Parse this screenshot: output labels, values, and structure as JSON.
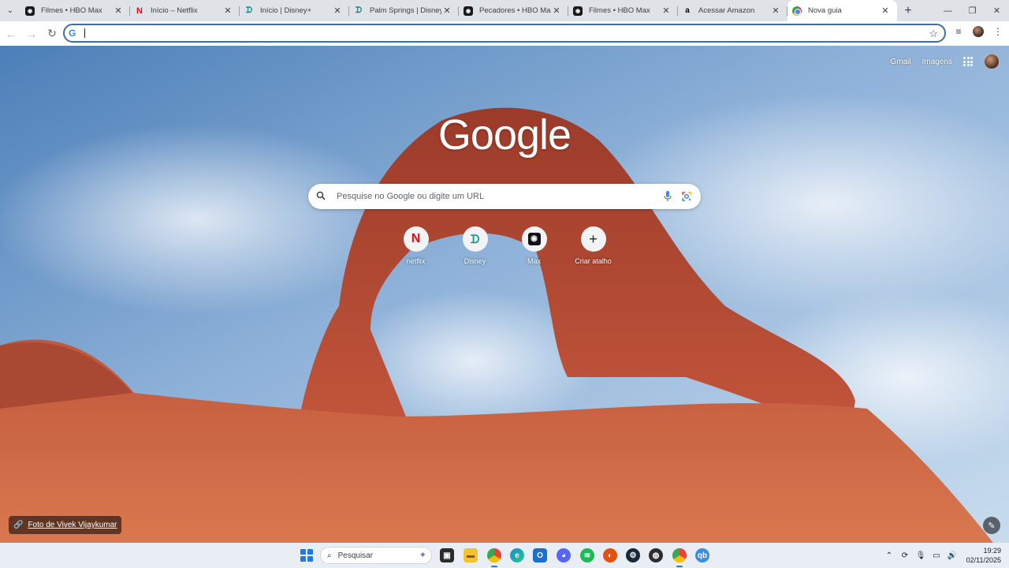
{
  "browser": {
    "tabs": [
      {
        "title": "Filmes • HBO Max",
        "favicon": "hbo-max-icon"
      },
      {
        "title": "Início – Netflix",
        "favicon": "netflix-icon"
      },
      {
        "title": "Início | Disney+",
        "favicon": "disney-plus-icon"
      },
      {
        "title": "Palm Springs | Disney+",
        "favicon": "disney-plus-icon"
      },
      {
        "title": "Pecadores • HBO Max",
        "favicon": "hbo-max-icon"
      },
      {
        "title": "Filmes • HBO Max",
        "favicon": "hbo-max-icon"
      },
      {
        "title": "Acessar Amazon",
        "favicon": "amazon-icon"
      },
      {
        "title": "Nova guia",
        "favicon": "chrome-icon",
        "active": true
      }
    ],
    "omnibox": {
      "value": "",
      "placeholder": ""
    },
    "accent": "#3b6ea8"
  },
  "ntp": {
    "top_links": {
      "gmail": "Gmail",
      "images": "Imagens"
    },
    "logo": "Google",
    "search": {
      "placeholder": "Pesquise no Google ou digite um URL"
    },
    "shortcuts": [
      {
        "label": "netflix",
        "icon": "netflix-icon"
      },
      {
        "label": "Disney",
        "icon": "disney-plus-icon"
      },
      {
        "label": "Max",
        "icon": "hbo-max-icon"
      },
      {
        "label": "Criar atalho",
        "icon": "plus-icon"
      }
    ],
    "photo_credit": "Foto de Vivek Vijaykumar"
  },
  "taskbar": {
    "search_label": "Pesquisar",
    "time": "19:29",
    "date": "02/11/2025"
  }
}
